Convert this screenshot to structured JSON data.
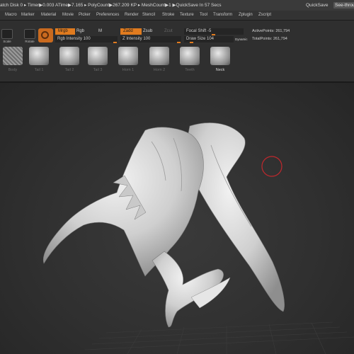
{
  "titlebar": {
    "status": "atch Disk 0 ▸ Timer▶0.003 ATime▶7.165 ▸ PolyCount▶267.209 KP ▸ MeshCount▶1 ▶QuickSave In 57 Secs",
    "quicksave": "QuickSave",
    "see_through": "See-throu"
  },
  "menubar": {
    "items": [
      "Macro",
      "Marker",
      "Material",
      "Movie",
      "Picker",
      "Preferences",
      "Render",
      "Stencil",
      "Stroke",
      "Texture",
      "Tool",
      "Transform",
      "Zplugin",
      "Zscript"
    ]
  },
  "toolbar": {
    "icons": [
      "Scale",
      "Rotate"
    ],
    "mrgb": "Mrgb",
    "rgb": "Rgb",
    "m": "M",
    "zadd": "Zadd",
    "zsub": "Zsub",
    "zcut": "Zcut",
    "rgb_intensity": "Rgb Intensity 100",
    "z_intensity": "Z Intensity 100",
    "focal_shift": "Focal Shift -5",
    "draw_size": "Draw Size 104",
    "dynamic": "Dynamic",
    "active_points": "ActivePoints: 261,794",
    "total_points": "TotalPoints: 261,794"
  },
  "levels": {
    "focal_shift_value": -5,
    "draw_size_value": 104,
    "rgb_intensity_value": 100,
    "z_intensity_value": 100
  },
  "subtools": {
    "labels": [
      "Body",
      "Tail 1",
      "Tail 2",
      "Tail 3",
      "Horn 1",
      "Horn 2",
      "Teeth",
      "Neck"
    ],
    "active_index": 7
  },
  "colors": {
    "accent": "#e07b1f",
    "brush_cursor": "#c0282d",
    "viewport_bg": "#303030",
    "model": "#d9d9d9"
  }
}
